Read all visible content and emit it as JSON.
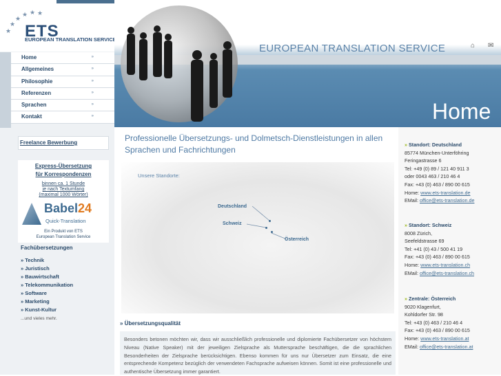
{
  "brand": {
    "logo_text": "ETS",
    "logo_sub": "EUROPEAN TRANSLATION SERVICE",
    "site_title": "EUROPEAN TRANSLATION SERVICE",
    "page_title": "Home"
  },
  "menu": [
    {
      "label": "Home"
    },
    {
      "label": "Allgemeines"
    },
    {
      "label": "Philosophie"
    },
    {
      "label": "Referenzen"
    },
    {
      "label": "Sprachen"
    },
    {
      "label": "Kontakt"
    }
  ],
  "freelance": "Freelance Bewerbung",
  "express": {
    "title1": "Express-Übersetzung",
    "title2": "für Korrespondenzen",
    "sub1": "binnen ca. 1 Stunde",
    "sub2": "je nach Textumfang",
    "sub3": "(maximal 1000 Wörter)",
    "babel_main": "Babel",
    "babel_num": "24",
    "babel_sub": "Quick-Translation",
    "foot1": "Ein Produkt von ETS",
    "foot2": "European Translation Service"
  },
  "fach": {
    "heading": "Fachübersetzungen",
    "items": [
      "» Technik",
      "» Juristisch",
      "» Bauwirtschaft",
      "» Telekommunikation",
      "» Software",
      "» Marketing",
      "» Kunst-Kultur"
    ],
    "more": "...und vieles mehr."
  },
  "main": {
    "headline": "Professionelle Übersetzungs- und Dolmetsch-Dienstleistungen in allen Sprachen und Fachrichtungen",
    "standorte": "Unsere Standorte:",
    "map_labels": [
      "Deutschland",
      "Schweiz",
      "Österreich"
    ],
    "q_title": "» Übersetzungsqualität",
    "q_text": "Besonders betonen möchten wir, dass wir ausschließlich professionelle und diplomierte Fachübersetzer von höchstem Niveau (Native Speaker) mit der jeweiligen Zielsprache als Muttersprache beschäftigen, die die sprachlichen Besonderheiten der Zielsprache berücksichtigen. Ebenso kommen für uns nur Übersetzer zum Einsatz, die eine entsprechende Kompetenz bezüglich der verwendeten Fachsprache aufweisen können. Somit ist eine professionelle und authentische Übersetzung immer garantiert."
  },
  "locations": [
    {
      "head": "Standort: Deutschland",
      "lines": [
        "85774 München-Unterföhring",
        "Feringastrasse 6",
        "Tel:  +49 (0) 89 / 121 40 911 3",
        "oder 0043 463 / 210 46 4",
        "Fax: +43 (0) 463 / 890 00 615"
      ],
      "home_label": "Home: ",
      "home": "www.ets-translation.de",
      "email_label": "EMail: ",
      "email": "office@ets-translation.de"
    },
    {
      "head": "Standort: Schweiz",
      "lines": [
        "8008 Zürich,",
        "Seefeldstrasse 69",
        "Tel:  +41 (0) 43 / 500 41 19",
        "Fax: +43 (0) 463 / 890 00 615"
      ],
      "home_label": "Home: ",
      "home": "www.ets-translation.ch",
      "email_label": "EMail: ",
      "email": "office@ets-translation.ch"
    },
    {
      "head": "Zentrale: Österreich",
      "lines": [
        "9020 Klagenfurt,",
        "Kohldorfer Str. 98",
        "Tel:  +43 (0) 463 / 210 46 4",
        "Fax: +43 (0) 463 / 890 00 615"
      ],
      "home_label": "Home: ",
      "home": "www.ets-translation.at",
      "email_label": "EMail: ",
      "email": "office@ets-translation.at"
    }
  ]
}
